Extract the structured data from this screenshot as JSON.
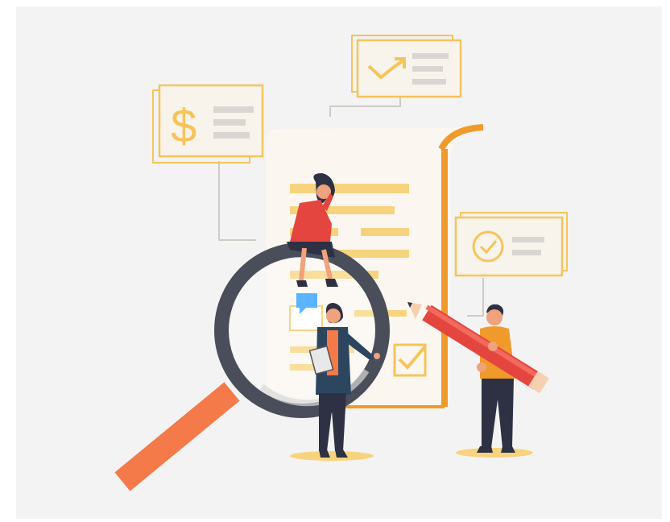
{
  "illustration": {
    "dollar_card": {
      "symbol": "$"
    },
    "colors": {
      "background": "#f3f3f3",
      "accent_yellow": "#f7c45a",
      "accent_orange": "#f09a2b",
      "card_lines": "#d9d6d2",
      "paper": "#fbf7f0",
      "magnifier_rim": "#4a4e5a",
      "magnifier_handle": "#f47a4a",
      "pencil_red": "#e4463f",
      "speech_blue": "#5ab4ff"
    }
  }
}
